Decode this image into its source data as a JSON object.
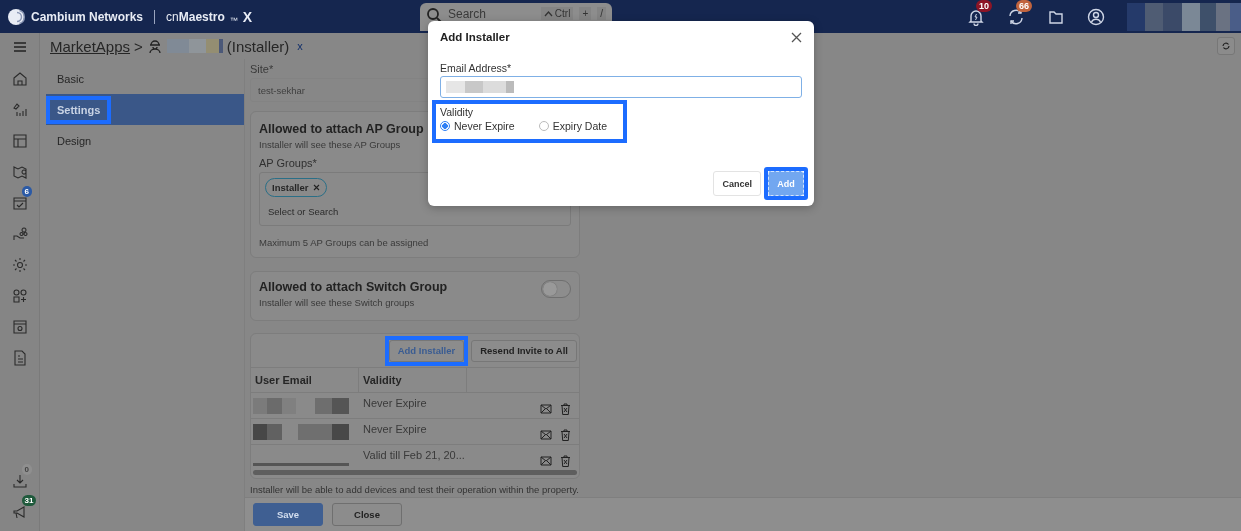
{
  "header": {
    "brand": "Cambium Networks",
    "product_prefix": "cn",
    "product": "Maestro",
    "product_mark": "™",
    "product_suffix": "X",
    "search": {
      "placeholder": "Search",
      "shortcut_key": "Ctrl",
      "shortcut_plus": "+",
      "shortcut_char": "/"
    },
    "alerts_badge": "10",
    "sync_badge": "66"
  },
  "rail": {
    "tasks_badge": "6",
    "downloads_badge": "0",
    "announcements_badge": "31"
  },
  "breadcrumb": {
    "root": "MarketApps",
    "separator": ">",
    "suffix": "(Installer)",
    "close": "x"
  },
  "subnav": [
    {
      "label": "Basic",
      "selected": false,
      "highlighted": false
    },
    {
      "label": "Settings",
      "selected": true,
      "highlighted": true
    },
    {
      "label": "Design",
      "selected": false,
      "highlighted": false
    }
  ],
  "site": {
    "label": "Site*",
    "value": "test-sekhar"
  },
  "ap_card": {
    "title": "Allowed to attach AP Group",
    "subtitle": "Installer will see these AP Groups",
    "field_label": "AP Groups*",
    "chips": [
      "Installer"
    ],
    "placeholder": "Select or Search",
    "hint": "Maximum 5 AP Groups can be assigned"
  },
  "switch_card": {
    "title": "Allowed to attach Switch Group",
    "subtitle": "Installer will see these Switch groups",
    "toggle_on": false
  },
  "installers": {
    "buttons": [
      {
        "label": "Add Installer",
        "highlighted": true,
        "kind": "primary"
      },
      {
        "label": "Resend Invite to All",
        "highlighted": false,
        "kind": "secondary"
      }
    ],
    "columns": [
      "User Email",
      "Validity"
    ],
    "rows": [
      {
        "validity": "Never Expire"
      },
      {
        "validity": "Never Expire"
      },
      {
        "validity": "Valid till Feb 21, 20..."
      }
    ],
    "note": "Installer will be able to add devices and test their operation within the property."
  },
  "footer": {
    "buttons": [
      {
        "label": "Save",
        "kind": "primary"
      },
      {
        "label": "Close",
        "kind": "secondary"
      }
    ]
  },
  "modal": {
    "title": "Add Installer",
    "email_label": "Email Address*",
    "validity": {
      "label": "Validity",
      "highlighted": true,
      "options": [
        {
          "label": "Never Expire",
          "selected": true
        },
        {
          "label": "Expiry Date",
          "selected": false
        }
      ]
    },
    "buttons": [
      {
        "label": "Cancel",
        "kind": "secondary",
        "highlighted": false
      },
      {
        "label": "Add",
        "kind": "primary",
        "highlighted": true
      }
    ]
  }
}
